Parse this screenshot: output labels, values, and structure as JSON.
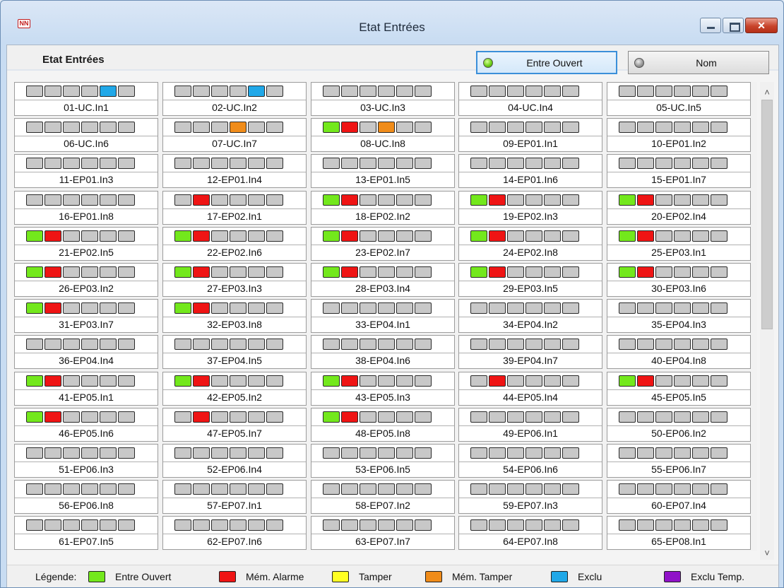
{
  "window": {
    "title": "Etat Entrées",
    "app_icon": "NN"
  },
  "header": {
    "title": "Etat Entrées",
    "btn_open_label": "Entre Ouvert",
    "btn_name_label": "Nom"
  },
  "colors": {
    "gray": "#c8c8c8",
    "green": "#73e81c",
    "red": "#ef1414",
    "orange": "#f08c1a",
    "blue": "#20a8e8",
    "yellow": "#ffff22",
    "purple": "#9012c8"
  },
  "legend": {
    "title": "Légende:",
    "items": [
      {
        "label": "Entre Ouvert",
        "color": "green"
      },
      {
        "label": "Mém. Alarme",
        "color": "red"
      },
      {
        "label": "Tamper",
        "color": "yellow"
      },
      {
        "label": "Mém. Tamper",
        "color": "orange"
      },
      {
        "label": "Exclu",
        "color": "blue"
      },
      {
        "label": "Exclu Temp.",
        "color": "purple"
      }
    ]
  },
  "inputs": [
    {
      "label": "01-UC.In1",
      "state": [
        "gray",
        "gray",
        "gray",
        "gray",
        "blue",
        "gray"
      ]
    },
    {
      "label": "02-UC.In2",
      "state": [
        "gray",
        "gray",
        "gray",
        "gray",
        "blue",
        "gray"
      ]
    },
    {
      "label": "03-UC.In3",
      "state": [
        "gray",
        "gray",
        "gray",
        "gray",
        "gray",
        "gray"
      ]
    },
    {
      "label": "04-UC.In4",
      "state": [
        "gray",
        "gray",
        "gray",
        "gray",
        "gray",
        "gray"
      ]
    },
    {
      "label": "05-UC.In5",
      "state": [
        "gray",
        "gray",
        "gray",
        "gray",
        "gray",
        "gray"
      ]
    },
    {
      "label": "06-UC.In6",
      "state": [
        "gray",
        "gray",
        "gray",
        "gray",
        "gray",
        "gray"
      ]
    },
    {
      "label": "07-UC.In7",
      "state": [
        "gray",
        "gray",
        "gray",
        "orange",
        "gray",
        "gray"
      ]
    },
    {
      "label": "08-UC.In8",
      "state": [
        "green",
        "red",
        "gray",
        "orange",
        "gray",
        "gray"
      ]
    },
    {
      "label": "09-EP01.In1",
      "state": [
        "gray",
        "gray",
        "gray",
        "gray",
        "gray",
        "gray"
      ]
    },
    {
      "label": "10-EP01.In2",
      "state": [
        "gray",
        "gray",
        "gray",
        "gray",
        "gray",
        "gray"
      ]
    },
    {
      "label": "11-EP01.In3",
      "state": [
        "gray",
        "gray",
        "gray",
        "gray",
        "gray",
        "gray"
      ]
    },
    {
      "label": "12-EP01.In4",
      "state": [
        "gray",
        "gray",
        "gray",
        "gray",
        "gray",
        "gray"
      ]
    },
    {
      "label": "13-EP01.In5",
      "state": [
        "gray",
        "gray",
        "gray",
        "gray",
        "gray",
        "gray"
      ]
    },
    {
      "label": "14-EP01.In6",
      "state": [
        "gray",
        "gray",
        "gray",
        "gray",
        "gray",
        "gray"
      ]
    },
    {
      "label": "15-EP01.In7",
      "state": [
        "gray",
        "gray",
        "gray",
        "gray",
        "gray",
        "gray"
      ]
    },
    {
      "label": "16-EP01.In8",
      "state": [
        "gray",
        "gray",
        "gray",
        "gray",
        "gray",
        "gray"
      ]
    },
    {
      "label": "17-EP02.In1",
      "state": [
        "gray",
        "red",
        "gray",
        "gray",
        "gray",
        "gray"
      ]
    },
    {
      "label": "18-EP02.In2",
      "state": [
        "green",
        "red",
        "gray",
        "gray",
        "gray",
        "gray"
      ]
    },
    {
      "label": "19-EP02.In3",
      "state": [
        "green",
        "red",
        "gray",
        "gray",
        "gray",
        "gray"
      ]
    },
    {
      "label": "20-EP02.In4",
      "state": [
        "green",
        "red",
        "gray",
        "gray",
        "gray",
        "gray"
      ]
    },
    {
      "label": "21-EP02.In5",
      "state": [
        "green",
        "red",
        "gray",
        "gray",
        "gray",
        "gray"
      ]
    },
    {
      "label": "22-EP02.In6",
      "state": [
        "green",
        "red",
        "gray",
        "gray",
        "gray",
        "gray"
      ]
    },
    {
      "label": "23-EP02.In7",
      "state": [
        "green",
        "red",
        "gray",
        "gray",
        "gray",
        "gray"
      ]
    },
    {
      "label": "24-EP02.In8",
      "state": [
        "green",
        "red",
        "gray",
        "gray",
        "gray",
        "gray"
      ]
    },
    {
      "label": "25-EP03.In1",
      "state": [
        "green",
        "red",
        "gray",
        "gray",
        "gray",
        "gray"
      ]
    },
    {
      "label": "26-EP03.In2",
      "state": [
        "green",
        "red",
        "gray",
        "gray",
        "gray",
        "gray"
      ]
    },
    {
      "label": "27-EP03.In3",
      "state": [
        "green",
        "red",
        "gray",
        "gray",
        "gray",
        "gray"
      ]
    },
    {
      "label": "28-EP03.In4",
      "state": [
        "green",
        "red",
        "gray",
        "gray",
        "gray",
        "gray"
      ]
    },
    {
      "label": "29-EP03.In5",
      "state": [
        "green",
        "red",
        "gray",
        "gray",
        "gray",
        "gray"
      ]
    },
    {
      "label": "30-EP03.In6",
      "state": [
        "green",
        "red",
        "gray",
        "gray",
        "gray",
        "gray"
      ]
    },
    {
      "label": "31-EP03.In7",
      "state": [
        "green",
        "red",
        "gray",
        "gray",
        "gray",
        "gray"
      ]
    },
    {
      "label": "32-EP03.In8",
      "state": [
        "green",
        "red",
        "gray",
        "gray",
        "gray",
        "gray"
      ]
    },
    {
      "label": "33-EP04.In1",
      "state": [
        "gray",
        "gray",
        "gray",
        "gray",
        "gray",
        "gray"
      ]
    },
    {
      "label": "34-EP04.In2",
      "state": [
        "gray",
        "gray",
        "gray",
        "gray",
        "gray",
        "gray"
      ]
    },
    {
      "label": "35-EP04.In3",
      "state": [
        "gray",
        "gray",
        "gray",
        "gray",
        "gray",
        "gray"
      ]
    },
    {
      "label": "36-EP04.In4",
      "state": [
        "gray",
        "gray",
        "gray",
        "gray",
        "gray",
        "gray"
      ]
    },
    {
      "label": "37-EP04.In5",
      "state": [
        "gray",
        "gray",
        "gray",
        "gray",
        "gray",
        "gray"
      ]
    },
    {
      "label": "38-EP04.In6",
      "state": [
        "gray",
        "gray",
        "gray",
        "gray",
        "gray",
        "gray"
      ]
    },
    {
      "label": "39-EP04.In7",
      "state": [
        "gray",
        "gray",
        "gray",
        "gray",
        "gray",
        "gray"
      ]
    },
    {
      "label": "40-EP04.In8",
      "state": [
        "gray",
        "gray",
        "gray",
        "gray",
        "gray",
        "gray"
      ]
    },
    {
      "label": "41-EP05.In1",
      "state": [
        "green",
        "red",
        "gray",
        "gray",
        "gray",
        "gray"
      ]
    },
    {
      "label": "42-EP05.In2",
      "state": [
        "green",
        "red",
        "gray",
        "gray",
        "gray",
        "gray"
      ]
    },
    {
      "label": "43-EP05.In3",
      "state": [
        "green",
        "red",
        "gray",
        "gray",
        "gray",
        "gray"
      ]
    },
    {
      "label": "44-EP05.In4",
      "state": [
        "gray",
        "red",
        "gray",
        "gray",
        "gray",
        "gray"
      ]
    },
    {
      "label": "45-EP05.In5",
      "state": [
        "green",
        "red",
        "gray",
        "gray",
        "gray",
        "gray"
      ]
    },
    {
      "label": "46-EP05.In6",
      "state": [
        "green",
        "red",
        "gray",
        "gray",
        "gray",
        "gray"
      ]
    },
    {
      "label": "47-EP05.In7",
      "state": [
        "gray",
        "red",
        "gray",
        "gray",
        "gray",
        "gray"
      ]
    },
    {
      "label": "48-EP05.In8",
      "state": [
        "green",
        "red",
        "gray",
        "gray",
        "gray",
        "gray"
      ]
    },
    {
      "label": "49-EP06.In1",
      "state": [
        "gray",
        "gray",
        "gray",
        "gray",
        "gray",
        "gray"
      ]
    },
    {
      "label": "50-EP06.In2",
      "state": [
        "gray",
        "gray",
        "gray",
        "gray",
        "gray",
        "gray"
      ]
    },
    {
      "label": "51-EP06.In3",
      "state": [
        "gray",
        "gray",
        "gray",
        "gray",
        "gray",
        "gray"
      ]
    },
    {
      "label": "52-EP06.In4",
      "state": [
        "gray",
        "gray",
        "gray",
        "gray",
        "gray",
        "gray"
      ]
    },
    {
      "label": "53-EP06.In5",
      "state": [
        "gray",
        "gray",
        "gray",
        "gray",
        "gray",
        "gray"
      ]
    },
    {
      "label": "54-EP06.In6",
      "state": [
        "gray",
        "gray",
        "gray",
        "gray",
        "gray",
        "gray"
      ]
    },
    {
      "label": "55-EP06.In7",
      "state": [
        "gray",
        "gray",
        "gray",
        "gray",
        "gray",
        "gray"
      ]
    },
    {
      "label": "56-EP06.In8",
      "state": [
        "gray",
        "gray",
        "gray",
        "gray",
        "gray",
        "gray"
      ]
    },
    {
      "label": "57-EP07.In1",
      "state": [
        "gray",
        "gray",
        "gray",
        "gray",
        "gray",
        "gray"
      ]
    },
    {
      "label": "58-EP07.In2",
      "state": [
        "gray",
        "gray",
        "gray",
        "gray",
        "gray",
        "gray"
      ]
    },
    {
      "label": "59-EP07.In3",
      "state": [
        "gray",
        "gray",
        "gray",
        "gray",
        "gray",
        "gray"
      ]
    },
    {
      "label": "60-EP07.In4",
      "state": [
        "gray",
        "gray",
        "gray",
        "gray",
        "gray",
        "gray"
      ]
    },
    {
      "label": "61-EP07.In5",
      "state": [
        "gray",
        "gray",
        "gray",
        "gray",
        "gray",
        "gray"
      ]
    },
    {
      "label": "62-EP07.In6",
      "state": [
        "gray",
        "gray",
        "gray",
        "gray",
        "gray",
        "gray"
      ]
    },
    {
      "label": "63-EP07.In7",
      "state": [
        "gray",
        "gray",
        "gray",
        "gray",
        "gray",
        "gray"
      ]
    },
    {
      "label": "64-EP07.In8",
      "state": [
        "gray",
        "gray",
        "gray",
        "gray",
        "gray",
        "gray"
      ]
    },
    {
      "label": "65-EP08.In1",
      "state": [
        "gray",
        "gray",
        "gray",
        "gray",
        "gray",
        "gray"
      ]
    },
    {
      "label": "",
      "state": [
        "gray",
        "gray",
        "gray",
        "gray",
        "gray",
        "gray"
      ]
    },
    {
      "label": "",
      "state": [
        "gray",
        "gray",
        "gray",
        "gray",
        "gray",
        "gray"
      ]
    },
    {
      "label": "",
      "state": [
        "gray",
        "gray",
        "gray",
        "gray",
        "gray",
        "gray"
      ]
    },
    {
      "label": "",
      "state": [
        "gray",
        "gray",
        "gray",
        "gray",
        "gray",
        "gray"
      ]
    },
    {
      "label": "",
      "state": [
        "gray",
        "gray",
        "gray",
        "gray",
        "gray",
        "gray"
      ]
    }
  ]
}
